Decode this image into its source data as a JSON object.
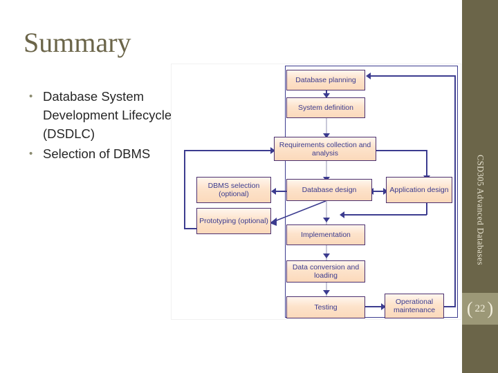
{
  "slide": {
    "title": "Summary",
    "bullets": [
      "Database System Development Lifecycle (DSDLC)",
      "Selection of DBMS"
    ],
    "sidebar_label": "CSD305 Advanced Databases",
    "page_number": "22",
    "bracket_left": "(",
    "bracket_right": ")"
  },
  "colors": {
    "title": "#6B6549",
    "sidebar": "#6B6549",
    "page_block": "#9C9877",
    "box_fill": "#FDE3CB",
    "box_border": "#4A2E6E",
    "connector": "#3B3B8F",
    "text": "#3B3B8F"
  },
  "chart_data": {
    "type": "diagram",
    "title": "Database System Development Lifecycle",
    "nodes": [
      {
        "id": "planning",
        "label": "Database planning"
      },
      {
        "id": "system_def",
        "label": "System definition"
      },
      {
        "id": "requirements",
        "label": "Requirements collection and analysis"
      },
      {
        "id": "dbms_selection",
        "label": "DBMS selection (optional)"
      },
      {
        "id": "db_design",
        "label": "Database design"
      },
      {
        "id": "app_design",
        "label": "Application design"
      },
      {
        "id": "prototyping",
        "label": "Prototyping (optional)"
      },
      {
        "id": "implementation",
        "label": "Implementation"
      },
      {
        "id": "data_conversion",
        "label": "Data conversion and loading"
      },
      {
        "id": "testing",
        "label": "Testing"
      },
      {
        "id": "operational",
        "label": "Operational maintenance"
      }
    ],
    "edges": [
      {
        "from": "planning",
        "to": "system_def"
      },
      {
        "from": "system_def",
        "to": "requirements"
      },
      {
        "from": "requirements",
        "to": "db_design"
      },
      {
        "from": "requirements",
        "to": "app_design"
      },
      {
        "from": "db_design",
        "to": "dbms_selection"
      },
      {
        "from": "db_design",
        "to": "app_design",
        "bidirectional": true
      },
      {
        "from": "db_design",
        "to": "prototyping"
      },
      {
        "from": "db_design",
        "to": "implementation"
      },
      {
        "from": "app_design",
        "to": "prototyping"
      },
      {
        "from": "prototyping",
        "to": "requirements"
      },
      {
        "from": "implementation",
        "to": "data_conversion"
      },
      {
        "from": "data_conversion",
        "to": "testing"
      },
      {
        "from": "testing",
        "to": "operational"
      },
      {
        "from": "operational",
        "to": "planning"
      }
    ]
  }
}
